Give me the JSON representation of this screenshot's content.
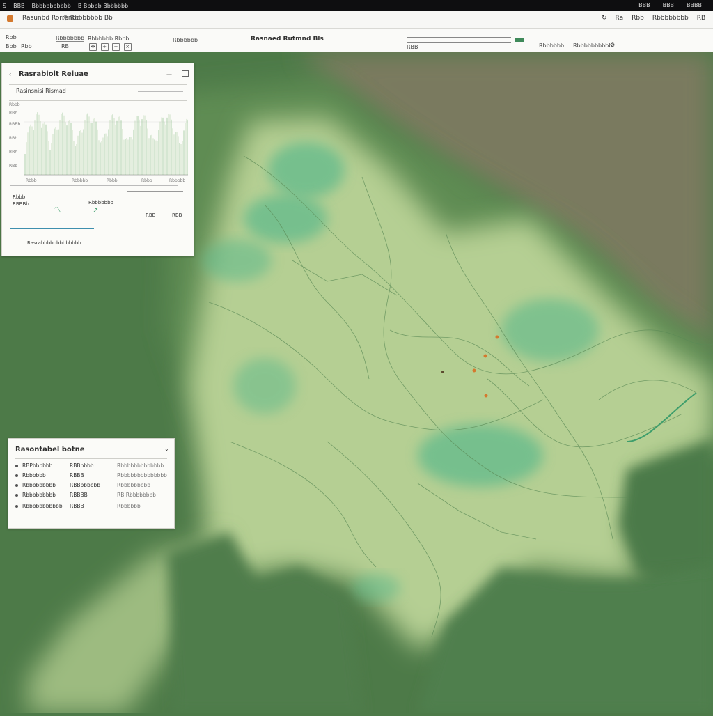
{
  "system_bar": {
    "items": [
      "S",
      "BBB",
      "Bbbbbbbbbbb",
      "B Bbbbb Bbbbbbb"
    ],
    "right_items": [
      "BBB",
      "BBB",
      "BBBB"
    ]
  },
  "topbar": {
    "app_title": "Rasunbd Rorrenbd",
    "tab_label": "Rbbbbbbb Bb",
    "right_items": [
      "Ra",
      "Rbb",
      "Rbbbbbbbb",
      "RB"
    ]
  },
  "toolbar": {
    "left_items": [
      "Rbb",
      "Bbb",
      "Rbb",
      "RB",
      "Rbbb",
      "RBB",
      "RB"
    ],
    "fields": [
      "Rbbbbbbb",
      "Rbbbbbb Rbbb",
      "Rbbbbbb"
    ],
    "map_title": "Rasnaed Rutmnd Bls",
    "right_items": [
      "RBB",
      "Rbbbbbb",
      "Rbbbbbbbbbb"
    ]
  },
  "analysis_panel": {
    "title": "Rasrabiolt Reiuae",
    "subtitle": "Rasinsnisi Rismad",
    "stats_label": "Rbbb",
    "footer_text": "Rasrabbbbbbbbbbbbb",
    "y_ticks": [
      "Rbbb",
      "RBb",
      "RBBb",
      "RBb",
      "RBb",
      "RBb"
    ],
    "x_ticks": [
      "Rbbb",
      "Rbbbbb",
      "Rbbb",
      "Rbbb",
      "Rbbbbb"
    ],
    "stat_labels": [
      "RBBBb",
      "Rbbbbbbb",
      "RBB",
      "RBB"
    ]
  },
  "legend_panel": {
    "title": "Rasontabel botne",
    "rows": [
      {
        "label": "RBPbbbbbb",
        "value": "RBBbbbb",
        "extra": "Rbbbbbbbbbbbbb"
      },
      {
        "label": "Rbbbbbb",
        "value": "RBBB",
        "extra": "Rbbbbbbbbbbbbbb"
      },
      {
        "label": "Rbbbbbbbbb",
        "value": "RBBbbbbbb",
        "extra": "Rbbbbbbbbb"
      },
      {
        "label": "Rbbbbbbbbb",
        "value": "RBBBB",
        "extra": "RB Rbbbbbbbb"
      },
      {
        "label": "Rbbbbbbbbbbb",
        "value": "RBBB",
        "extra": "Rbbbbbb"
      }
    ]
  },
  "colors": {
    "forest_dark": "#4d7a48",
    "forest_mid": "#6e9a5f",
    "plain_light": "#b5cf93",
    "water_teal": "#5bb98b",
    "olive_background": "#7a7a5e",
    "accent_marker": "#d4792e"
  }
}
